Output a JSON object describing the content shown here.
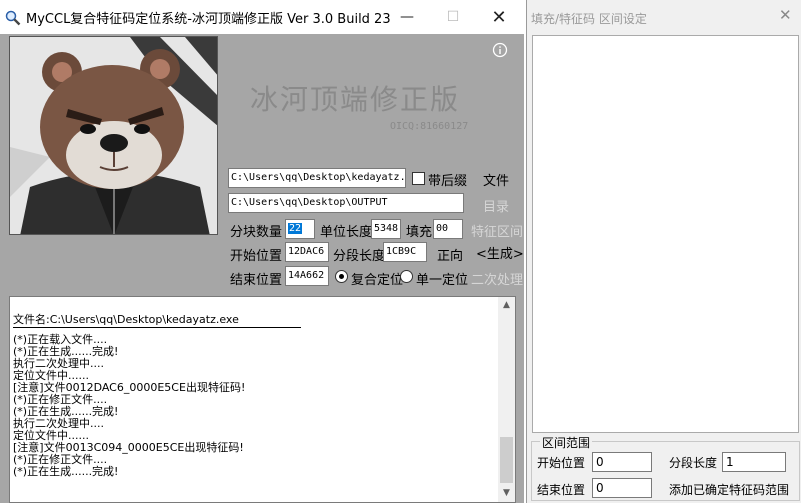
{
  "main_window": {
    "title": "MyCCL复合特征码定位系统-冰河顶端修正版  Ver 3.0  Build 23",
    "minimize_symbol": "—",
    "maximize_symbol": "☐",
    "close_symbol": "✕",
    "brand_text": "冰河顶端修正版",
    "oicq_text": "OICQ:81660127",
    "info_symbol": "i",
    "file_path": "C:\\Users\\qq\\Desktop\\kedayatz.",
    "with_suffix_label": "带后缀",
    "file_button": "文件",
    "output_path": "C:\\Users\\qq\\Desktop\\OUTPUT",
    "dir_button": "目录",
    "block_count_label": "分块数量",
    "block_count_value": "22",
    "unit_length_label": "单位长度",
    "unit_length_value": "5348",
    "fill_label": "填充",
    "fill_value": "00",
    "feature_range_button": "特征区间",
    "start_label": "开始位置",
    "start_value": "12DAC6",
    "segment_length_label": "分段长度",
    "segment_length_value": "1CB9C",
    "direction_button": "正向",
    "generate_button": "<生成>",
    "end_label": "结束位置",
    "end_value": "14A662",
    "composite_locate_label": "复合定位",
    "single_locate_label": "单一定位",
    "secondary_process_button": "二次处理",
    "log": {
      "filename_line": "文件名:C:\\Users\\qq\\Desktop\\kedayatz.exe",
      "lines": [
        "(*)正在载入文件....",
        "(*)正在生成......完成!",
        "执行二次处理中....",
        "定位文件中......",
        "[注意]文件0012DAC6_0000E5CE出现特征码!",
        "(*)正在修正文件....",
        "(*)正在生成......完成!",
        "执行二次处理中....",
        "定位文件中......",
        "[注意]文件0013C094_0000E5CE出现特征码!",
        "(*)正在修正文件....",
        "(*)正在生成......完成!"
      ]
    }
  },
  "side_window": {
    "title": "填充/特征码 区间设定",
    "close_symbol": "✕",
    "group_title": "区间范围",
    "start_label": "开始位置",
    "start_value": "0",
    "segment_length_label": "分段长度",
    "segment_length_value": "1",
    "end_label": "结束位置",
    "end_value": "0",
    "add_button": "添加已确定特征码范围"
  }
}
